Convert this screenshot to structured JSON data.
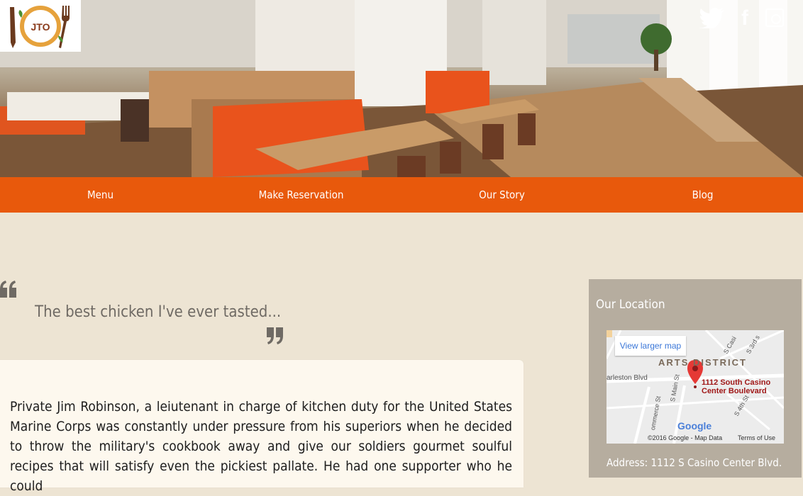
{
  "logo": {
    "text": "JTO"
  },
  "social": {
    "twitter": "twitter-icon",
    "facebook": "f",
    "instagram": "instagram-icon"
  },
  "nav": {
    "items": [
      "Menu",
      "Make Reservation",
      "Our Story",
      "Blog"
    ]
  },
  "quote": {
    "text": "The best chicken I've ever tasted..."
  },
  "story": {
    "text": "Private Jim Robinson, a leiutenant in charge of kitchen duty for the United States Marine Corps was constantly under pressure from his superiors when he decided to throw the military's cookbook away and give our soldiers gourmet soulful recipes that will satisfy even the pickiest pallate. He had one supporter who he could"
  },
  "location": {
    "title": "Our Location",
    "map": {
      "larger_map": "View larger map",
      "district": "ARTS DISTRICT",
      "street1": "arleston Blvd",
      "street2": "S Main St",
      "street3": "ommerce St",
      "street4": "S 4th St",
      "street5": "S Casi",
      "street6": "S 3rd s",
      "pin_label_1": "1112 South Casino",
      "pin_label_2": "Center Boulevard",
      "google": "Google",
      "copyright": "©2016 Google - Map Data",
      "terms": "Terms of Use"
    },
    "address": "Address: 1112 S Casino Center Blvd."
  },
  "colors": {
    "accent": "#e8590c",
    "background": "#ede4d3",
    "card": "#fdf8ee",
    "sidebar": "#b6ad9f"
  }
}
